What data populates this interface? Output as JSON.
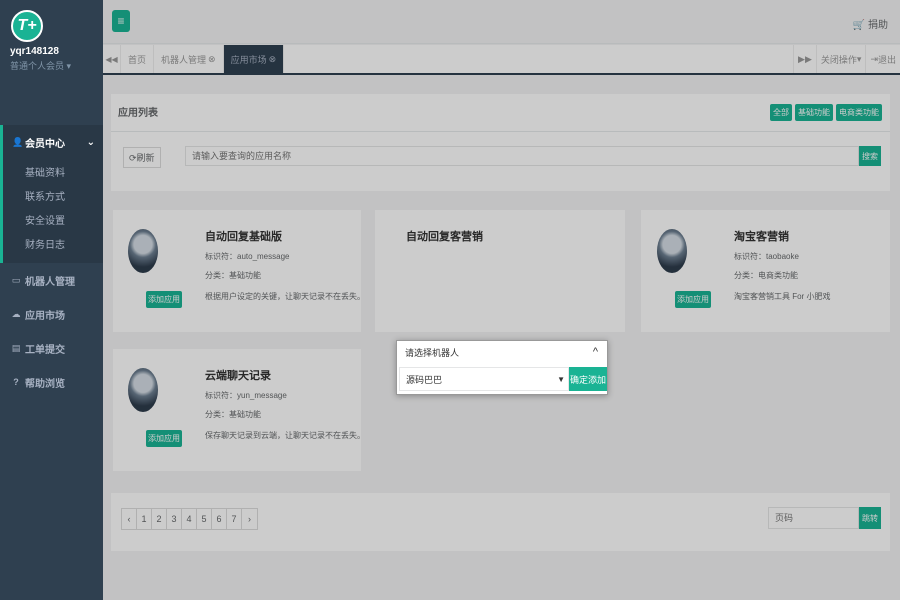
{
  "sidebar": {
    "avatar_text": "T+",
    "username": "yqr148128",
    "role": "普通个人会员",
    "member_center": "会员中心",
    "sub_items": [
      "基础资料",
      "联系方式",
      "安全设置",
      "财务日志"
    ],
    "items": [
      "机器人管理",
      "应用市场",
      "工单提交",
      "帮助浏览"
    ]
  },
  "topbar": {
    "menu_icon": "≡",
    "donate": "捐助"
  },
  "tabs": {
    "items": [
      "首页",
      "机器人管理",
      "应用市场"
    ],
    "close_ops": "关闭操作",
    "logout": "退出"
  },
  "app_list": {
    "title": "应用列表",
    "filters": [
      "全部",
      "基础功能",
      "电商类功能"
    ],
    "refresh": "刷新",
    "search_placeholder": "请输入要查询的应用名称",
    "search_btn": "搜索"
  },
  "cards": [
    {
      "name": "自动回复基础版",
      "id_line": "标识符：auto_message",
      "cat_line": "分类：基础功能",
      "desc": "根据用户设定的关键，让聊天记录不在丢失。",
      "add_btn": "添加应用"
    },
    {
      "name": "自动回复客营销",
      "id_line": "",
      "cat_line": "",
      "desc": "",
      "add_btn": ""
    },
    {
      "name": "淘宝客营销",
      "id_line": "标识符：taobaoke",
      "cat_line": "分类：电商类功能",
      "desc": "淘宝客营销工具 For 小肥戏",
      "add_btn": "添加应用"
    },
    {
      "name": "云端聊天记录",
      "id_line": "标识符：yun_message",
      "cat_line": "分类：基础功能",
      "desc": "保存聊天记录到云端，让聊天记录不在丢失。",
      "add_btn": "添加应用"
    }
  ],
  "pagination": {
    "pages": [
      "‹",
      "1",
      "2",
      "3",
      "4",
      "5",
      "6",
      "7",
      "›"
    ],
    "page_placeholder": "页码",
    "jump_btn": "跳转"
  },
  "dialog": {
    "title": "请选择机器人",
    "close": "^",
    "select_value": "源码巴巴",
    "confirm": "确定添加"
  },
  "colors": {
    "accent": "#1ab394",
    "sidebar": "#2f4050"
  }
}
